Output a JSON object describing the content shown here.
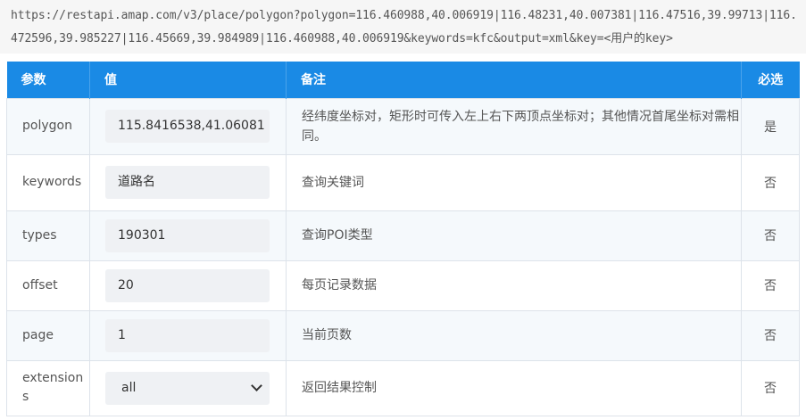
{
  "request_url": "https://restapi.amap.com/v3/place/polygon?polygon=116.460988,40.006919|116.48231,40.007381|116.47516,39.99713|116.472596,39.985227|116.45669,39.984989|116.460988,40.006919&keywords=kfc&output=xml&key=<用户的key>",
  "table": {
    "headers": [
      "参数",
      "值",
      "备注",
      "必选"
    ],
    "rows": [
      {
        "name": "polygon",
        "value": "115.8416538,41.06081",
        "note": "经纬度坐标对，矩形时可传入左上右下两顶点坐标对；其他情况首尾坐标对需相同。",
        "required": "是"
      },
      {
        "name": "keywords",
        "value": "道路名",
        "note": "查询关键词",
        "required": "否"
      },
      {
        "name": "types",
        "value": "190301",
        "note": "查询POI类型",
        "required": "否"
      },
      {
        "name": "offset",
        "value": "20",
        "note": "每页记录数据",
        "required": "否"
      },
      {
        "name": "page",
        "value": "1",
        "note": "当前页数",
        "required": "否"
      },
      {
        "name": "extensions",
        "value": "all",
        "note": "返回结果控制",
        "required": "否"
      }
    ]
  },
  "colors": {
    "header_bg": "#1a8ae5",
    "row_alt_bg": "#f5f9fc",
    "field_bg": "#eff1f4"
  },
  "icons": {
    "select_arrow": "chevron-down-icon"
  }
}
